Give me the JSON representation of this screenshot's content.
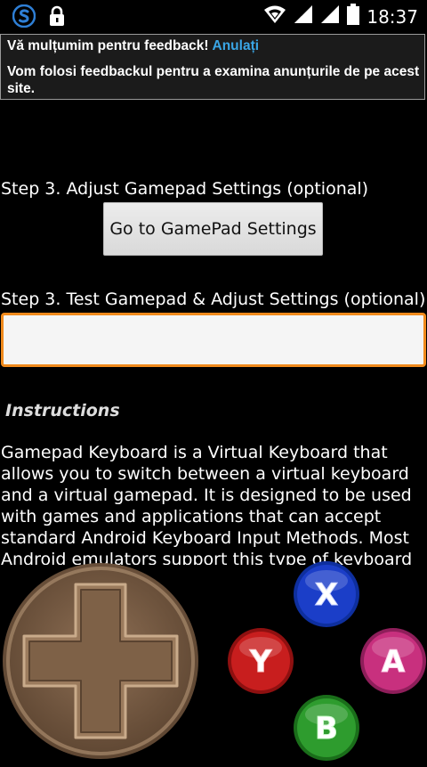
{
  "status_bar": {
    "time": "18:37",
    "icons": [
      "s-app-icon",
      "lock-icon",
      "wifi-icon",
      "signal-icon",
      "signal-icon",
      "battery-icon"
    ]
  },
  "banner": {
    "title": "Vă mulțumim pentru feedback!",
    "undo_label": "Anulați",
    "message": "Vom folosi feedbackul pentru a examina anunțurile de pe acest site."
  },
  "main": {
    "step_adjust_label": "Step 3. Adjust Gamepad Settings (optional)",
    "gamepad_settings_button": "Go to GamePad Settings",
    "step_test_label": "Step 3. Test Gamepad & Adjust Settings (optional)",
    "test_input_value": "",
    "instructions_title": "Instructions",
    "instructions_text": " Gamepad Keyboard is a Virtual Keyboard that allows you to switch between a virtual keyboard and a virtual gamepad. It is designed to be used with games and applications that can accept standard Android Keyboard Input Methods. Most Android emulators support this type of keyboard"
  },
  "gamepad": {
    "buttons": [
      {
        "label": "X",
        "color": "#1b3ec8"
      },
      {
        "label": "Y",
        "color": "#c81e1e"
      },
      {
        "label": "A",
        "color": "#c8307e"
      },
      {
        "label": "B",
        "color": "#2e9c2e"
      }
    ],
    "dpad_color": "#8a6a4e"
  },
  "colors": {
    "accent_link": "#3aa6e6",
    "input_focus": "#f08a1c"
  }
}
